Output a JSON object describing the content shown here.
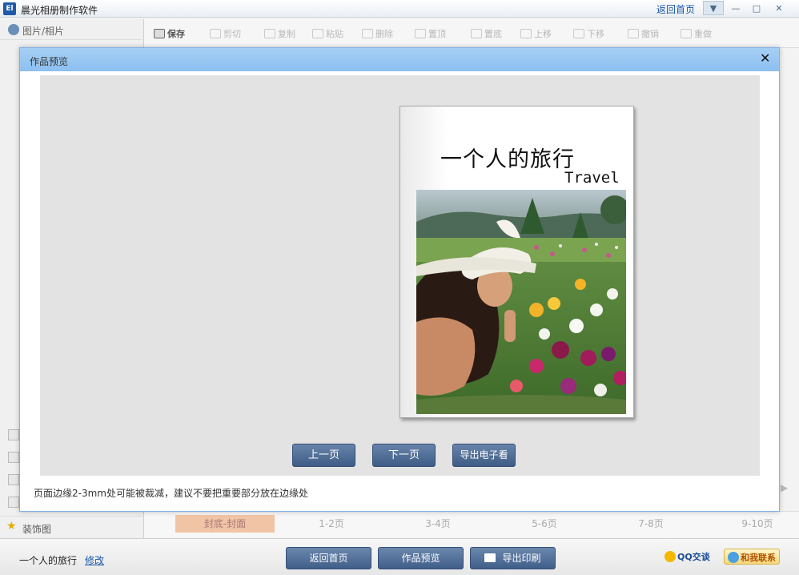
{
  "app": {
    "icon_text": "El",
    "title": "晨光相册制作软件",
    "home_link": "返回首页"
  },
  "window_controls": {
    "menu_glyph": "▼",
    "min_glyph": "—",
    "max_glyph": "□",
    "close_glyph": "✕"
  },
  "left_panel": {
    "photos_label": "图片/相片",
    "decorations_label": "装饰图"
  },
  "toolbar": {
    "items": [
      {
        "label": "保存",
        "icon": "save-icon"
      },
      {
        "label": "剪切",
        "icon": "cut-icon"
      },
      {
        "label": "复制",
        "icon": "copy-icon"
      },
      {
        "label": "粘贴",
        "icon": "paste-icon"
      },
      {
        "label": "删除",
        "icon": "delete-icon"
      },
      {
        "label": "置顶",
        "icon": "bring-front-icon"
      },
      {
        "label": "置底",
        "icon": "send-back-icon"
      },
      {
        "label": "上移",
        "icon": "move-up-icon"
      },
      {
        "label": "下移",
        "icon": "move-down-icon"
      },
      {
        "label": "撤销",
        "icon": "undo-icon"
      },
      {
        "label": "重做",
        "icon": "redo-icon"
      }
    ]
  },
  "page_tabs": [
    {
      "label": "封底-封面",
      "active": true
    },
    {
      "label": "1-2页",
      "active": false
    },
    {
      "label": "3-4页",
      "active": false
    },
    {
      "label": "5-6页",
      "active": false
    },
    {
      "label": "7-8页",
      "active": false
    },
    {
      "label": "9-10页",
      "active": false
    }
  ],
  "dialog": {
    "title": "作品预览",
    "close_glyph": "✕",
    "book": {
      "title": "一个人的旅行",
      "subtitle": "Travel"
    },
    "buttons": {
      "prev": "上一页",
      "next": "下一页",
      "export_ebook": "导出电子看"
    },
    "note": "页面边缘2-3mm处可能被裁减，建议不要把重要部分放在边缘处"
  },
  "bottom": {
    "project_name": "一个人的旅行",
    "edit_link": "修改",
    "buttons": {
      "home": "返回首页",
      "preview": "作品预览",
      "print": "导出印刷"
    },
    "qq_label": "QQ交谈",
    "contact_label": "和我联系"
  },
  "colors": {
    "accent": "#4a6a96",
    "dialog_header": "#9ccaf3",
    "preview_bg": "#e3e3e3",
    "active_tab": "#f2c4a6"
  }
}
